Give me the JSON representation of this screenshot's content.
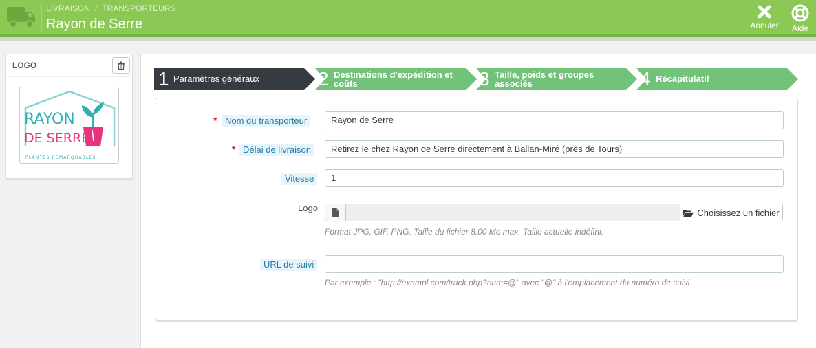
{
  "header": {
    "breadcrumb": [
      "LIVRAISON",
      "TRANSPORTEURS"
    ],
    "breadcrumb_separator": "/",
    "title": "Rayon de Serre",
    "icon": "truck-icon",
    "actions": [
      {
        "label": "Annuler",
        "icon": "close-icon"
      },
      {
        "label": "Aide",
        "icon": "lifebuoy-icon"
      }
    ]
  },
  "logo_panel": {
    "title": "LOGO",
    "delete_icon": "trash-icon",
    "logo_text_line1": "RAYON",
    "logo_text_line2": "DE SERRE",
    "logo_tagline": "PLANTES REMARQUABLES"
  },
  "wizard": {
    "steps": [
      {
        "number": "1",
        "label": "Paramètres généraux",
        "active": true
      },
      {
        "number": "2",
        "label_line1": "Destinations d'expédition et",
        "label_line2": "coûts",
        "active": false
      },
      {
        "number": "3",
        "label_line1": "Taille, poids et groupes",
        "label_line2": "associés",
        "active": false
      },
      {
        "number": "4",
        "label": "Récapitulatif",
        "active": false
      }
    ]
  },
  "form": {
    "carrier_name": {
      "label": "Nom du transporteur",
      "required": true,
      "value": "Rayon de Serre"
    },
    "delay": {
      "label": "Délai de livraison",
      "required": true,
      "value": "Retirez le chez Rayon de Serre directement à Ballan-Miré (près de Tours)"
    },
    "speed": {
      "label": "Vitesse",
      "value": "1"
    },
    "logo": {
      "label": "Logo",
      "button_label": "Choisissez un fichier",
      "help": "Format JPG, GIF, PNG. Taille du fichier 8.00 Mo max. Taille actuelle indéfini."
    },
    "tracking_url": {
      "label": "URL de suivi",
      "value": "",
      "help": "Par exemple : \"http://exampl.com/track.php?num=@\" avec \"@\" à l'emplacement du numéro de suivi."
    }
  },
  "colors": {
    "header_green": "#8bc954",
    "step_active": "#363a41",
    "step_inactive": "#72c279",
    "label_chip_bg": "#e6f4fb",
    "required_star": "#e02020"
  }
}
